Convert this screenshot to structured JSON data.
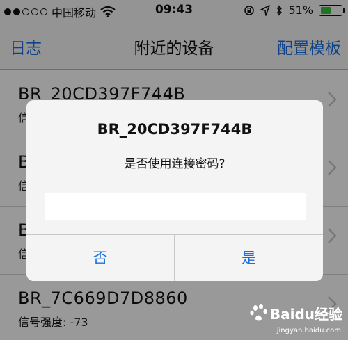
{
  "status_bar": {
    "carrier": "中国移动",
    "time": "09:43",
    "battery_percent": "51%",
    "battery_level": 0.51,
    "signal_dots_filled": 2
  },
  "nav": {
    "left_label": "日志",
    "title": "附近的设备",
    "right_label": "配置模板"
  },
  "devices": [
    {
      "name": "BR_20CD397F744B",
      "signal_label": "信"
    },
    {
      "name": "B",
      "signal_label": "信"
    },
    {
      "name": "B",
      "signal_label": "信"
    },
    {
      "name": "BR_7C669D7D8860",
      "signal_label": "信号强度: -73"
    }
  ],
  "alert": {
    "title": "BR_20CD397F744B",
    "message": "是否使用连接密码?",
    "input_value": "",
    "button_no": "否",
    "button_yes": "是"
  },
  "watermark": {
    "text": "Baidu经验",
    "url": "jingyan.baidu.com"
  },
  "colors": {
    "accent": "#1a6fe0",
    "battery": "#38c23a"
  }
}
